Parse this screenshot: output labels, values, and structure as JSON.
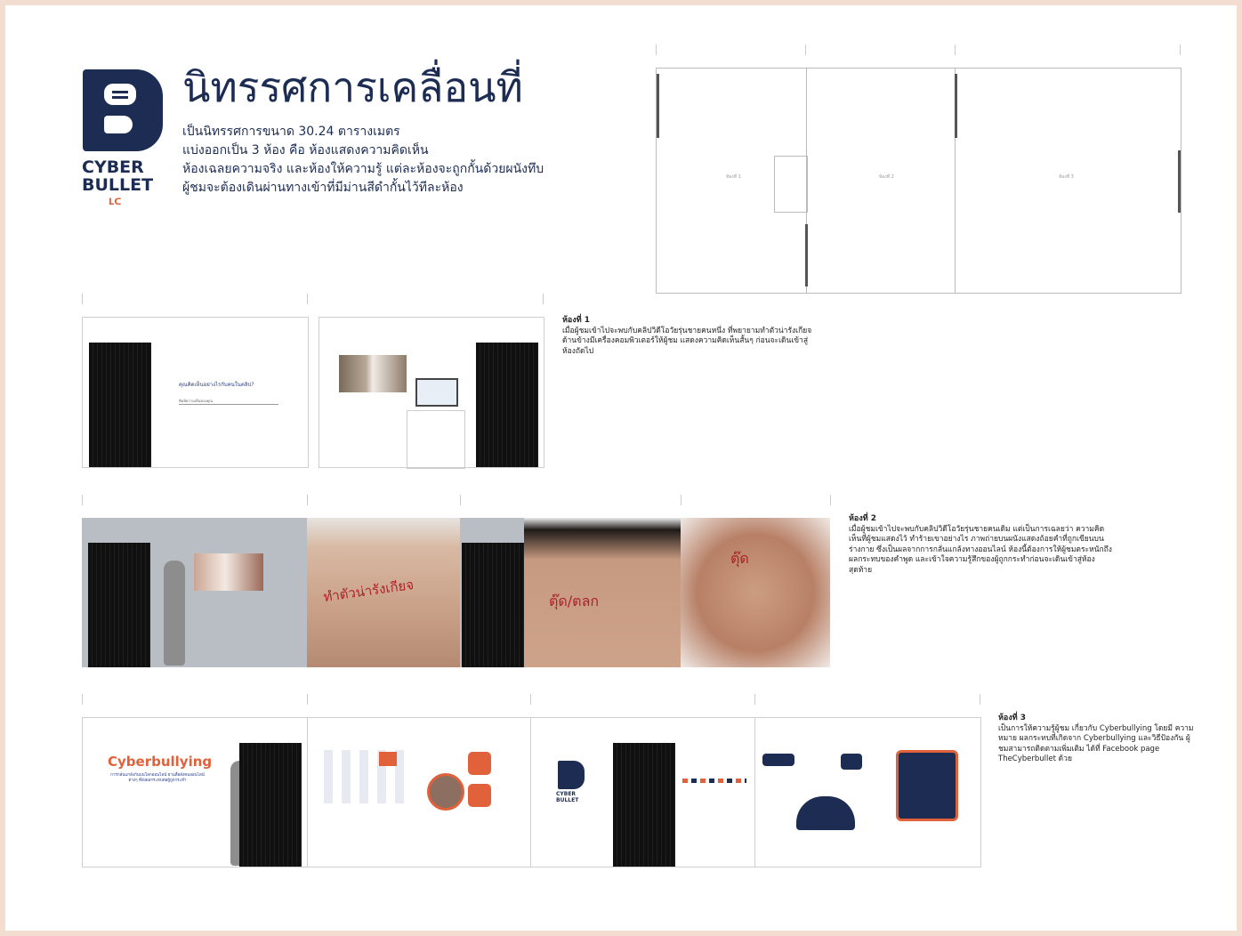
{
  "logo": {
    "line1": "CYBER",
    "line2": "BULLET",
    "sub": "ᒪᑕ"
  },
  "title": "นิทรรศการเคลื่อนที่",
  "intro": [
    "เป็นนิทรรศการขนาด 30.24 ตารางเมตร",
    "แบ่งออกเป็น 3 ห้อง คือ ห้องแสดงความคิดเห็น",
    "ห้องเฉลยความจริง และห้องให้ความรู้ แต่ละห้องจะถูกกั้นด้วยผนังทึบ",
    "ผู้ชมจะต้องเดินผ่านทางเข้าที่มีม่านสีดำกั้นไว้ทีละห้อง"
  ],
  "room1": {
    "heading": "ห้องที่ 1",
    "text": "เมื่อผู้ชมเข้าไปจะพบกับคลิปวิดีโอวัยรุ่นชายคนหนึ่ง ที่พยายามทำตัวน่ารังเกียจ ด้านข้างมีเครื่องคอมพิวเตอร์ให้ผู้ชม แสดงความคิดเห็นสั้นๆ ก่อนจะเดินเข้าสู่ห้องถัดไป",
    "panel_text": "คุณคิดเห็นอย่างไรกับคนในคลิป?",
    "panel_sub": "พิมพ์ความเห็นของคุณ"
  },
  "room2": {
    "heading": "ห้องที่ 2",
    "text": "เมื่อผู้ชมเข้าไปจะพบกับคลิปวิดีโอวัยรุ่นชายคนเดิม แต่เป็นการเฉลยว่า ความคิดเห็นที่ผู้ชมแสดงไว้ ทำร้ายเขาอย่างไร ภาพถ่ายบนผนังแสดงถ้อยคำที่ถูกเขียนบนร่างกาย ซึ่งเป็นผลจากการกลั่นแกล้งทางออนไลน์ ห้องนี้ต้องการให้ผู้ชมตระหนักถึงผลกระทบของคำพูด และเข้าใจความรู้สึกของผู้ถูกกระทำก่อนจะเดินเข้าสู่ห้องสุดท้าย",
    "body_text1": "ทำตัวน่ารังเกียจ",
    "body_text2": "ตุ๊ด/ตลก",
    "body_text3": "ตุ๊ด"
  },
  "room3": {
    "heading": "ห้องที่ 3",
    "text": "เป็นการให้ความรู้ผู้ชม เกี่ยวกับ Cyberbullying โดยมี ความหมาย ผลกระทบที่เกิดจาก Cyberbullying และวิธีป้องกัน ผู้ชมสามารถติดตามเพิ่มเติม ได้ที่ Facebook page TheCyberbullet ด้วย",
    "poster_title": "Cyberbullying",
    "poster_text": "การกลั่นแกล้งกันบนโลกออนไลน์ ผ่านสื่อสังคมออนไลน์ต่างๆ ที่ส่งผลกระทบต่อผู้ถูกกระทำ",
    "logo1": "CYBER",
    "logo2": "BULLET"
  },
  "room_labels": [
    "ห้องที่ 1",
    "ห้องที่ 2",
    "ห้องที่ 3"
  ],
  "colors": {
    "navy": "#1c2c52",
    "accent": "#e0613a",
    "door": "#151515"
  }
}
